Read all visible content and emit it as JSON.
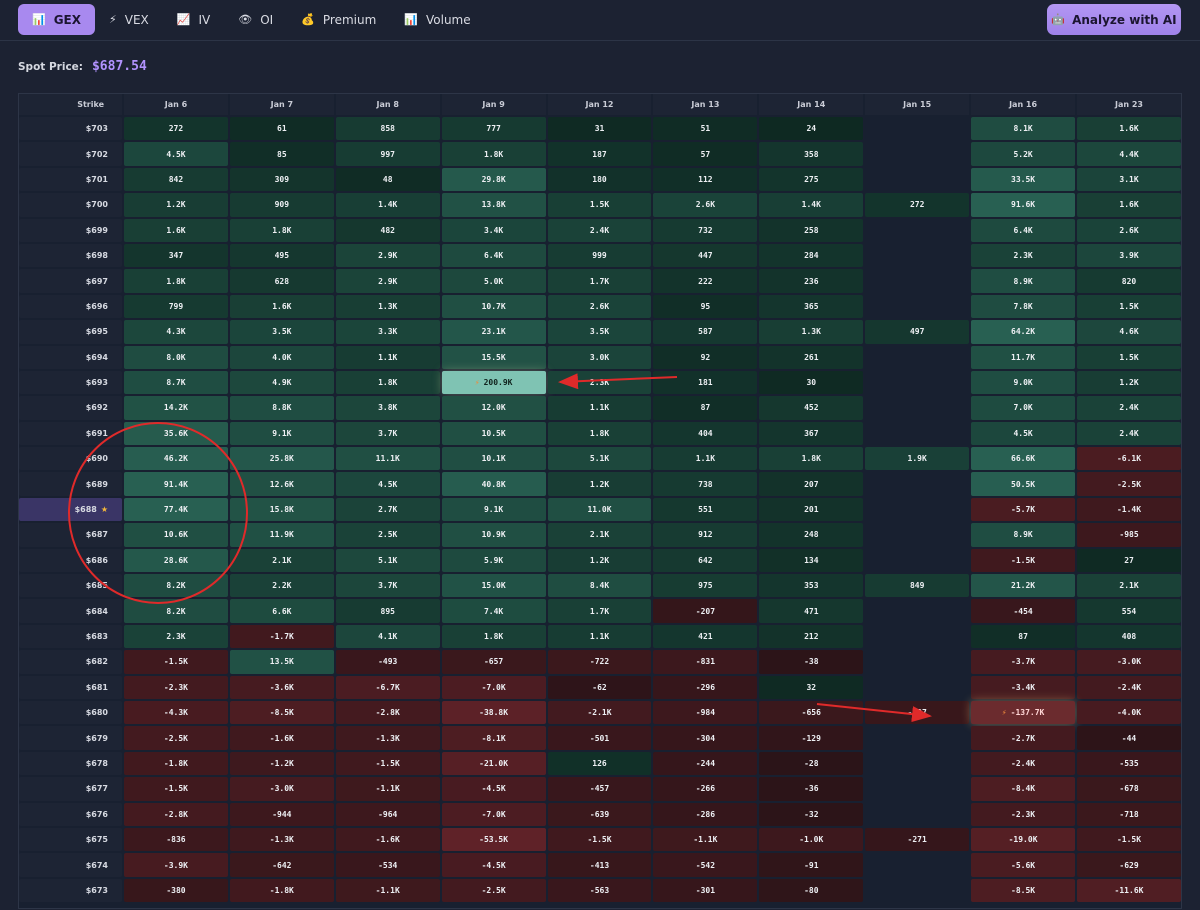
{
  "tabs": [
    {
      "label": "GEX",
      "icon": "📊",
      "icon_name": "bar-chart-icon",
      "active": true
    },
    {
      "label": "VEX",
      "icon": "⚡",
      "icon_name": "lightning-icon",
      "active": false
    },
    {
      "label": "IV",
      "icon": "📈",
      "icon_name": "line-chart-icon",
      "active": false
    },
    {
      "label": "OI",
      "icon": "👁",
      "icon_name": "eye-icon",
      "active": false
    },
    {
      "label": "Premium",
      "icon": "💰",
      "icon_name": "money-bag-icon",
      "active": false
    },
    {
      "label": "Volume",
      "icon": "📊",
      "icon_name": "bar-chart-icon",
      "active": false
    }
  ],
  "ai_button": {
    "label": "Analyze with AI",
    "icon": "🤖",
    "icon_name": "robot-icon"
  },
  "spot": {
    "label": "Spot Price:",
    "value": "$687.54"
  },
  "grid": {
    "strike_header": "Strike",
    "columns": [
      "Jan 6",
      "Jan 7",
      "Jan 8",
      "Jan 9",
      "Jan 12",
      "Jan 13",
      "Jan 14",
      "Jan 15",
      "Jan 16",
      "Jan 23"
    ],
    "spot_strike": "$688",
    "rows": [
      {
        "strike": "$703",
        "values": [
          "272",
          "61",
          "858",
          "777",
          "31",
          "51",
          "24",
          "",
          "8.1K",
          "1.6K"
        ]
      },
      {
        "strike": "$702",
        "values": [
          "4.5K",
          "85",
          "997",
          "1.8K",
          "187",
          "57",
          "358",
          "",
          "5.2K",
          "4.4K"
        ]
      },
      {
        "strike": "$701",
        "values": [
          "842",
          "309",
          "48",
          "29.8K",
          "180",
          "112",
          "275",
          "",
          "33.5K",
          "3.1K"
        ]
      },
      {
        "strike": "$700",
        "values": [
          "1.2K",
          "909",
          "1.4K",
          "13.8K",
          "1.5K",
          "2.6K",
          "1.4K",
          "272",
          "91.6K",
          "1.6K"
        ]
      },
      {
        "strike": "$699",
        "values": [
          "1.6K",
          "1.8K",
          "482",
          "3.4K",
          "2.4K",
          "732",
          "258",
          "",
          "6.4K",
          "2.6K"
        ]
      },
      {
        "strike": "$698",
        "values": [
          "347",
          "495",
          "2.9K",
          "6.4K",
          "999",
          "447",
          "284",
          "",
          "2.3K",
          "3.9K"
        ]
      },
      {
        "strike": "$697",
        "values": [
          "1.8K",
          "628",
          "2.9K",
          "5.0K",
          "1.7K",
          "222",
          "236",
          "",
          "8.9K",
          "820"
        ]
      },
      {
        "strike": "$696",
        "values": [
          "799",
          "1.6K",
          "1.3K",
          "10.7K",
          "2.6K",
          "95",
          "365",
          "",
          "7.8K",
          "1.5K"
        ]
      },
      {
        "strike": "$695",
        "values": [
          "4.3K",
          "3.5K",
          "3.3K",
          "23.1K",
          "3.5K",
          "587",
          "1.3K",
          "497",
          "64.2K",
          "4.6K"
        ]
      },
      {
        "strike": "$694",
        "values": [
          "8.0K",
          "4.0K",
          "1.1K",
          "15.5K",
          "3.0K",
          "92",
          "261",
          "",
          "11.7K",
          "1.5K"
        ]
      },
      {
        "strike": "$693",
        "values": [
          "8.7K",
          "4.9K",
          "1.8K",
          "200.9K",
          "2.3K",
          "181",
          "30",
          "",
          "9.0K",
          "1.2K"
        ]
      },
      {
        "strike": "$692",
        "values": [
          "14.2K",
          "8.8K",
          "3.8K",
          "12.0K",
          "1.1K",
          "87",
          "452",
          "",
          "7.0K",
          "2.4K"
        ]
      },
      {
        "strike": "$691",
        "values": [
          "35.6K",
          "9.1K",
          "3.7K",
          "10.5K",
          "1.8K",
          "404",
          "367",
          "",
          "4.5K",
          "2.4K"
        ]
      },
      {
        "strike": "$690",
        "values": [
          "46.2K",
          "25.8K",
          "11.1K",
          "10.1K",
          "5.1K",
          "1.1K",
          "1.8K",
          "1.9K",
          "66.6K",
          "-6.1K"
        ]
      },
      {
        "strike": "$689",
        "values": [
          "91.4K",
          "12.6K",
          "4.5K",
          "40.8K",
          "1.2K",
          "738",
          "207",
          "",
          "50.5K",
          "-2.5K"
        ]
      },
      {
        "strike": "$688",
        "values": [
          "77.4K",
          "15.8K",
          "2.7K",
          "9.1K",
          "11.0K",
          "551",
          "201",
          "",
          "-5.7K",
          "-1.4K"
        ]
      },
      {
        "strike": "$687",
        "values": [
          "10.6K",
          "11.9K",
          "2.5K",
          "10.9K",
          "2.1K",
          "912",
          "248",
          "",
          "8.9K",
          "-985"
        ]
      },
      {
        "strike": "$686",
        "values": [
          "28.6K",
          "2.1K",
          "5.1K",
          "5.9K",
          "1.2K",
          "642",
          "134",
          "",
          "-1.5K",
          "27"
        ]
      },
      {
        "strike": "$685",
        "values": [
          "8.2K",
          "2.2K",
          "3.7K",
          "15.0K",
          "8.4K",
          "975",
          "353",
          "849",
          "21.2K",
          "2.1K"
        ]
      },
      {
        "strike": "$684",
        "values": [
          "8.2K",
          "6.6K",
          "895",
          "7.4K",
          "1.7K",
          "-207",
          "471",
          "",
          "-454",
          "554"
        ]
      },
      {
        "strike": "$683",
        "values": [
          "2.3K",
          "-1.7K",
          "4.1K",
          "1.8K",
          "1.1K",
          "421",
          "212",
          "",
          "87",
          "408"
        ]
      },
      {
        "strike": "$682",
        "values": [
          "-1.5K",
          "13.5K",
          "-493",
          "-657",
          "-722",
          "-831",
          "-38",
          "",
          "-3.7K",
          "-3.0K"
        ]
      },
      {
        "strike": "$681",
        "values": [
          "-2.3K",
          "-3.6K",
          "-6.7K",
          "-7.0K",
          "-62",
          "-296",
          "32",
          "",
          "-3.4K",
          "-2.4K"
        ]
      },
      {
        "strike": "$680",
        "values": [
          "-4.3K",
          "-8.5K",
          "-2.8K",
          "-38.8K",
          "-2.1K",
          "-984",
          "-656",
          "-427",
          "-137.7K",
          "-4.0K"
        ]
      },
      {
        "strike": "$679",
        "values": [
          "-2.5K",
          "-1.6K",
          "-1.3K",
          "-8.1K",
          "-501",
          "-304",
          "-129",
          "",
          "-2.7K",
          "-44"
        ]
      },
      {
        "strike": "$678",
        "values": [
          "-1.8K",
          "-1.2K",
          "-1.5K",
          "-21.0K",
          "126",
          "-244",
          "-28",
          "",
          "-2.4K",
          "-535"
        ]
      },
      {
        "strike": "$677",
        "values": [
          "-1.5K",
          "-3.0K",
          "-1.1K",
          "-4.5K",
          "-457",
          "-266",
          "-36",
          "",
          "-8.4K",
          "-678"
        ]
      },
      {
        "strike": "$676",
        "values": [
          "-2.8K",
          "-944",
          "-964",
          "-7.0K",
          "-639",
          "-286",
          "-32",
          "",
          "-2.3K",
          "-718"
        ]
      },
      {
        "strike": "$675",
        "values": [
          "-836",
          "-1.3K",
          "-1.6K",
          "-53.5K",
          "-1.5K",
          "-1.1K",
          "-1.0K",
          "-271",
          "-19.0K",
          "-1.5K"
        ]
      },
      {
        "strike": "$674",
        "values": [
          "-3.9K",
          "-642",
          "-534",
          "-4.5K",
          "-413",
          "-542",
          "-91",
          "",
          "-5.6K",
          "-629"
        ]
      },
      {
        "strike": "$673",
        "values": [
          "-380",
          "-1.8K",
          "-1.1K",
          "-2.5K",
          "-563",
          "-301",
          "-80",
          "",
          "-8.5K",
          "-11.6K"
        ]
      }
    ],
    "flagged_cells": [
      {
        "strike": "$693",
        "column": "Jan 9",
        "icon": "⚡",
        "icon_name": "lightning-icon",
        "sign": "positive"
      },
      {
        "strike": "$680",
        "column": "Jan 16",
        "icon": "⚡",
        "icon_name": "lightning-icon",
        "sign": "negative"
      }
    ],
    "spot_marker": {
      "icon": "★",
      "icon_name": "star-icon"
    }
  },
  "annotations": {
    "color": "#e02a2a",
    "circle_around": {
      "column": "Jan 6",
      "strikes": [
        "$691",
        "$690",
        "$689",
        "$688",
        "$687",
        "$686",
        "$685"
      ]
    },
    "arrows_point_to": [
      "$693 / Jan 9",
      "$680 / Jan 16"
    ]
  },
  "colors": {
    "background": "#1c2232",
    "accent": "#a889ef",
    "spot_value": "#b293ff",
    "positive_base": "#0c2a22",
    "negative_base": "#2a1217",
    "highlight_positive": "#7fc3b3",
    "highlight_negative": "#6b2b2e"
  }
}
